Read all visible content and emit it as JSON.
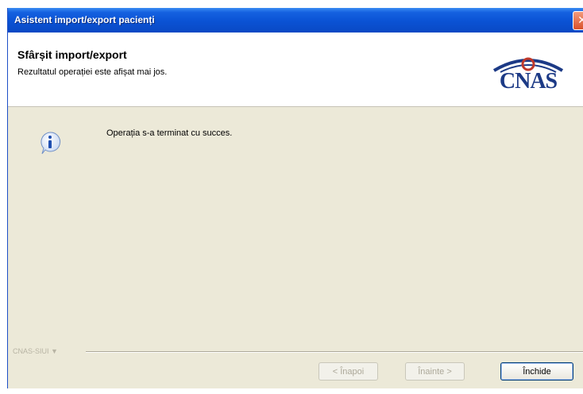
{
  "window": {
    "title": "Asistent import/export pacienți",
    "close_glyph": "✕"
  },
  "header": {
    "title": "Sfârșit import/export",
    "subtitle": "Rezultatul operației este afișat mai jos.",
    "logo_text": "CNAS"
  },
  "main": {
    "icon": "info-icon",
    "message": "Operația s-a terminat cu succes."
  },
  "footer": {
    "label": "CNAS-SIUI ▼",
    "back_label": "< Înapoi",
    "next_label": "Înainte >",
    "close_label": "Închide"
  },
  "colors": {
    "titlebar": "#0a52d4",
    "dialog_bg": "#ece9d8",
    "logo_blue": "#1c3a86",
    "logo_red": "#c0392b"
  }
}
